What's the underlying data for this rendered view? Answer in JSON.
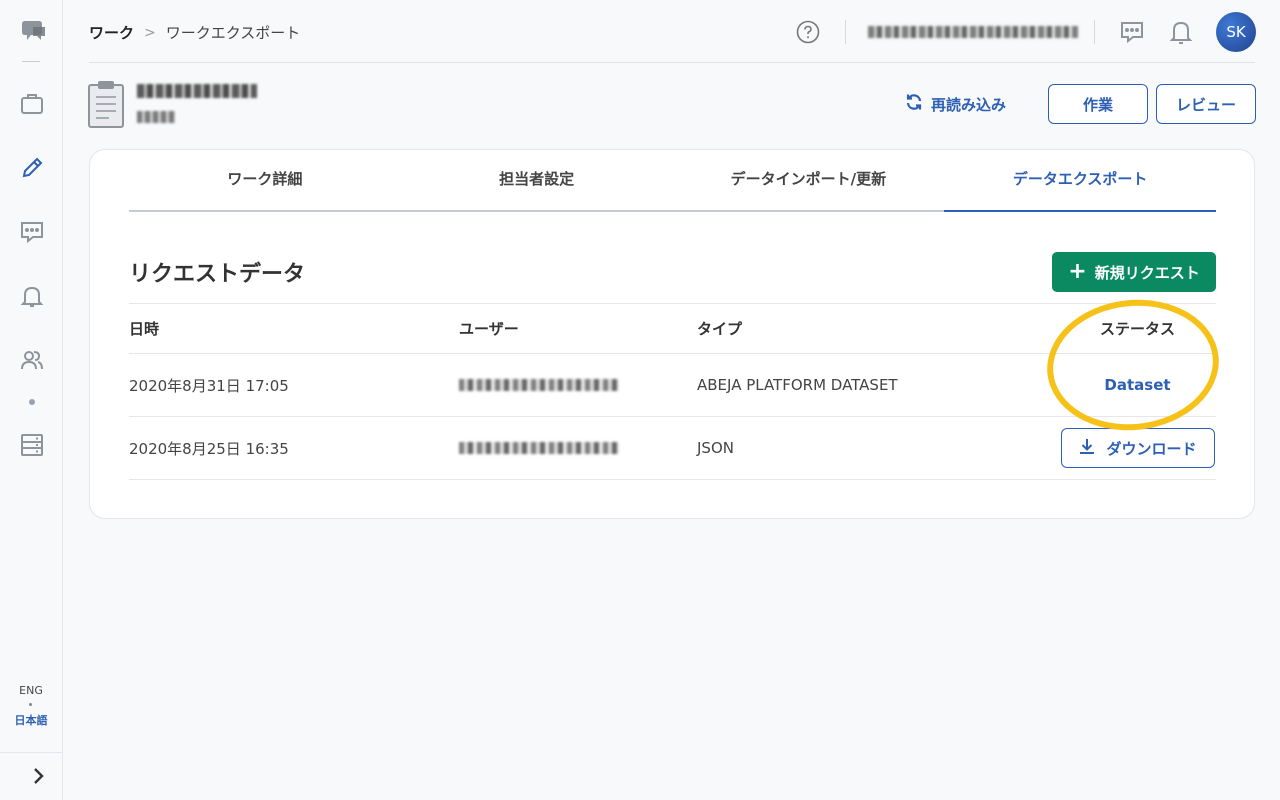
{
  "sidebar": {
    "lang_en": "ENG",
    "lang_ja": "日本語"
  },
  "header": {
    "breadcrumb_root": "ワーク",
    "breadcrumb_separator": ">",
    "breadcrumb_current": "ワークエクスポート",
    "avatar_initials": "SK"
  },
  "project": {
    "reload_label": "再読み込み",
    "work_label": "作業",
    "review_label": "レビュー"
  },
  "tabs": [
    {
      "label": "ワーク詳細"
    },
    {
      "label": "担当者設定"
    },
    {
      "label": "データインポート/更新"
    },
    {
      "label": "データエクスポート"
    }
  ],
  "section": {
    "title": "リクエストデータ",
    "new_request_plus": "+",
    "new_request_label": "新規リクエスト"
  },
  "table": {
    "headers": {
      "date": "日時",
      "user": "ユーザー",
      "type": "タイプ",
      "status": "ステータス"
    },
    "rows": [
      {
        "date": "2020年8月31日 17:05",
        "type": "ABEJA PLATFORM DATASET",
        "status": "Dataset"
      },
      {
        "date": "2020年8月25日 16:35",
        "type": "JSON",
        "status": "ダウンロード"
      }
    ]
  },
  "colors": {
    "accent": "#2d5fb4",
    "primary_green": "#0b8a62",
    "highlight": "#f6c21a"
  }
}
